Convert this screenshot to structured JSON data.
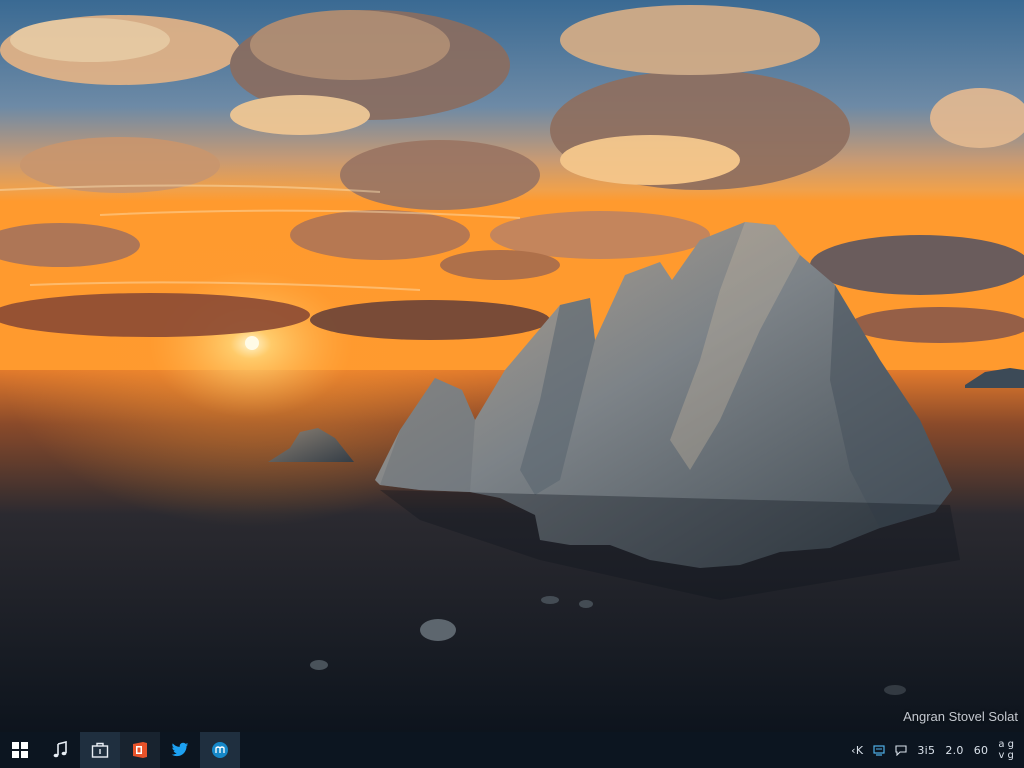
{
  "desktop": {
    "wallpaper": "sunset over calm sea with rock island",
    "watermark": "Angran Stovel Solat"
  },
  "taskbar": {
    "apps": [
      {
        "name": "start",
        "icon": "windows-logo-icon"
      },
      {
        "name": "music",
        "icon": "music-note-icon"
      },
      {
        "name": "store",
        "icon": "store-bag-icon"
      },
      {
        "name": "office",
        "icon": "office-icon",
        "color": "#e8532a"
      },
      {
        "name": "twitter",
        "icon": "twitter-bird-icon",
        "color": "#1da1f2"
      },
      {
        "name": "app",
        "icon": "circle-app-icon",
        "color": "#1688c9"
      }
    ],
    "tray": {
      "chevron": "‹K",
      "network": "network-icon",
      "chat": "chat-icon",
      "text1": "3i5",
      "text2": "2.0",
      "text3": "60",
      "clock_top": "a g",
      "clock_bottom": "v g"
    }
  }
}
